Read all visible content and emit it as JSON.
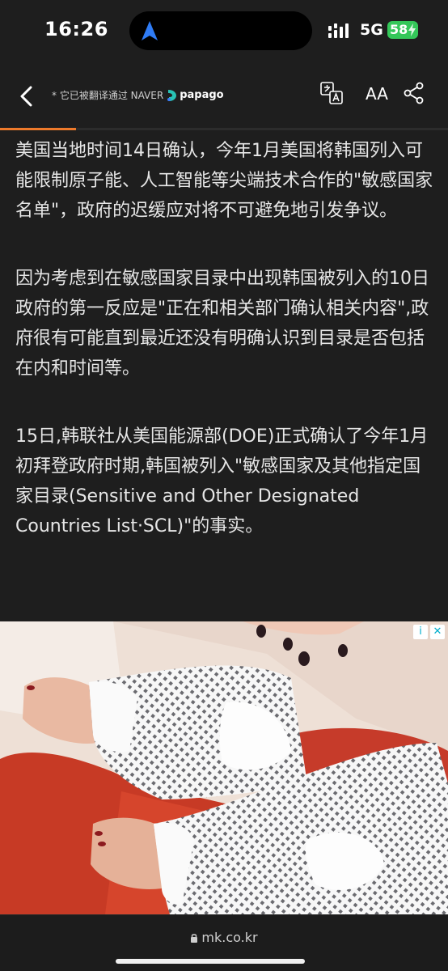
{
  "status_bar": {
    "time": "16:26",
    "network": "5G",
    "battery": "58",
    "icons": [
      "navigation-arrow-icon",
      "signal-icon",
      "battery-icon"
    ]
  },
  "header": {
    "translate_note": "* 它已被翻译通过 NAVER",
    "translator_brand": "papago",
    "font_button_label": "AA",
    "reading_progress": 0.17,
    "icons": [
      "back-icon",
      "translate-icon",
      "font-size-icon",
      "share-icon"
    ],
    "accent_color": "#ee7a2b"
  },
  "article": {
    "paragraphs": [
      "美国当地时间14日确认，今年1月美国将韩国列入可能限制原子能、人工智能等尖端技术合作的\"敏感国家名单\"，政府的迟缓应对将不可避免地引发争议。",
      "因为考虑到在敏感国家目录中出现韩国被列入的10日政府的第一反应是\"正在和相关部门确认相关内容\",政府很有可能直到最近还没有明确认识到目录是否包括在内和时间等。",
      "15日,韩联社从美国能源部(DOE)正式确认了今年1月初拜登政府时期,韩国被列入\"敏感国家及其他指定国家目录(Sensitive and Other Designated Countries List·SCL)\"的事实。"
    ]
  },
  "ad": {
    "badge_info": "i",
    "badge_close": "✕",
    "icons": [
      "ad-info-icon",
      "ad-close-icon"
    ]
  },
  "browser": {
    "url": "mk.co.kr",
    "icons": [
      "lock-icon"
    ]
  }
}
